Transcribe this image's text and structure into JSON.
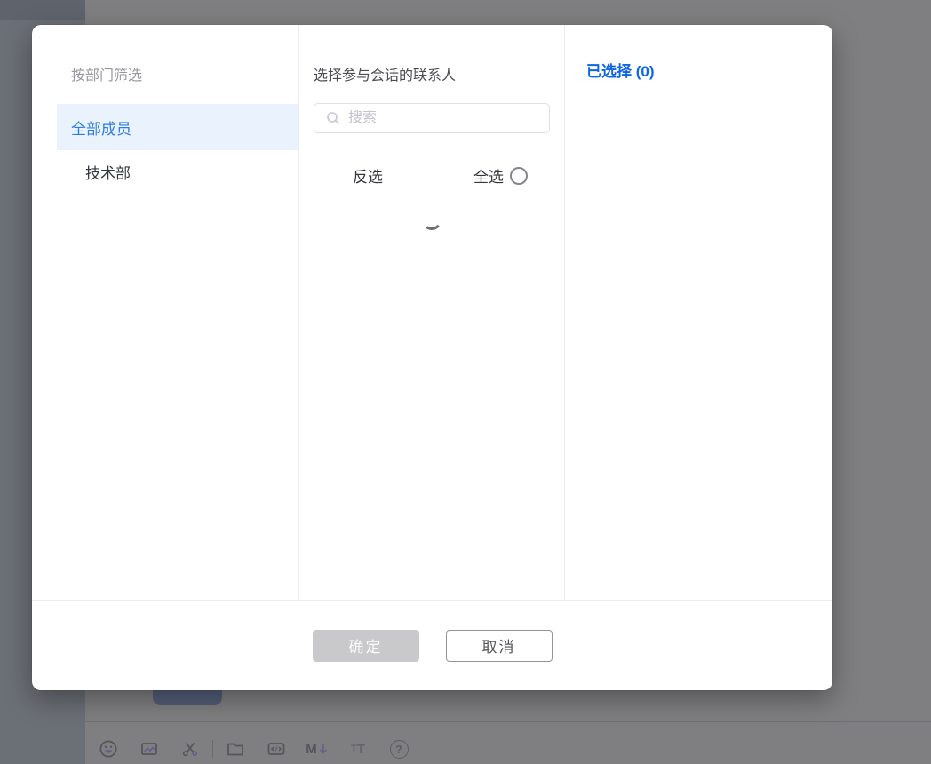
{
  "dialog": {
    "left_panel": {
      "header": "按部门筛选",
      "items": [
        {
          "label": "全部成员",
          "selected": true
        },
        {
          "label": "技术部",
          "selected": false
        }
      ]
    },
    "middle_panel": {
      "header": "选择参与会话的联系人",
      "search_placeholder": "搜索",
      "search_value": "",
      "invert_label": "反选",
      "select_all_label": "全选",
      "select_all_checked": false,
      "loading": true
    },
    "right_panel": {
      "selected_label": "已选择",
      "selected_count": "(0)"
    },
    "footer": {
      "confirm_label": "确定",
      "confirm_disabled": true,
      "cancel_label": "取消"
    }
  },
  "background_toolbar": {
    "icons": [
      "emoji-icon",
      "image-icon",
      "screenshot-scissors-icon",
      "folder-icon",
      "code-icon",
      "markdown-icon",
      "font-size-icon",
      "help-icon"
    ],
    "markdown_letter": "M",
    "font_letter_small": "T",
    "font_letter_large": "T",
    "help_glyph": "?"
  },
  "colors": {
    "accent_blue": "#0d66e4",
    "selected_item_text": "#2e7de2",
    "selected_item_bg": "#e9f2fd",
    "overlay_gray": "#7f7f81",
    "confirm_disabled_bg": "#c9c9cb"
  }
}
